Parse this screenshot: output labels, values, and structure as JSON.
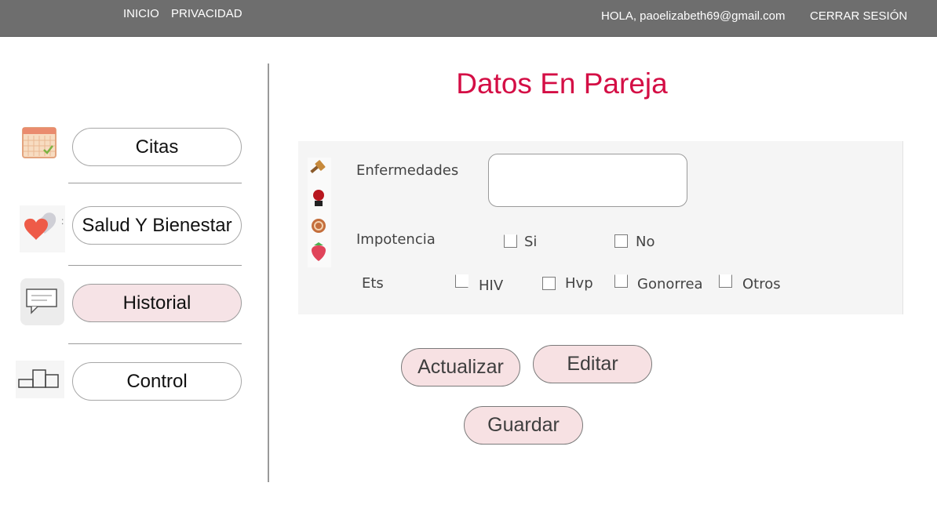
{
  "topbar": {
    "inicio": "INICIO",
    "privacidad": "PRIVACIDAD",
    "greeting": "HOLA, paoelizabeth69@gmail.com",
    "logout": "CERRAR SESIÓN"
  },
  "sidebar": {
    "items": [
      {
        "label": "Citas",
        "icon": "calendar-icon"
      },
      {
        "label": "Salud Y Bienestar",
        "icon": "hearts-icon"
      },
      {
        "label": "Historial",
        "icon": "chat-bubble-icon"
      },
      {
        "label": "Control",
        "icon": "podium-icon"
      }
    ]
  },
  "page": {
    "title": "Datos En Pareja"
  },
  "form": {
    "enfermedades_label": "Enfermedades",
    "impotencia_label": "Impotencia",
    "impotencia_options": [
      "Si",
      "No"
    ],
    "ets_label": "Ets",
    "ets_options": [
      "HIV",
      "Hvp",
      "Gonorrea",
      "Otros"
    ]
  },
  "actions": {
    "actualizar": "Actualizar",
    "editar": "Editar",
    "guardar": "Guardar"
  },
  "colors": {
    "title": "#d40e45",
    "topbar": "#6e6e6e",
    "button_fill": "#f7e1e3"
  }
}
